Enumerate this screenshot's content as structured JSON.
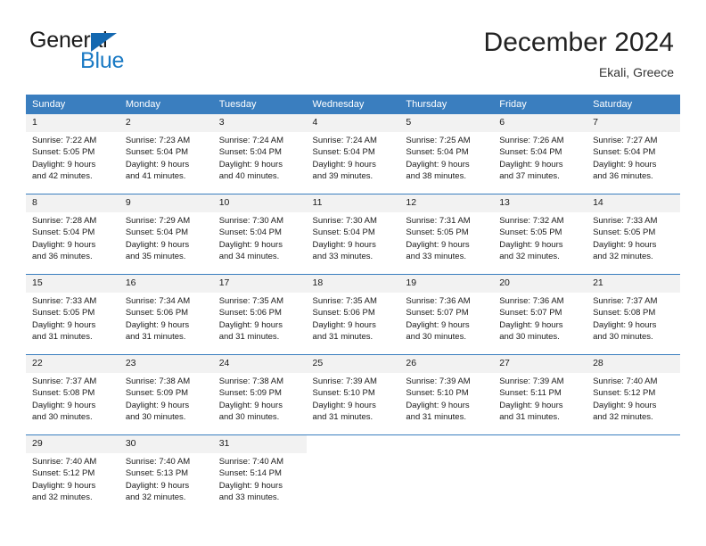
{
  "brand": {
    "word_one": "General",
    "word_two": "Blue",
    "triangle_icon": "blue-triangle-icon",
    "accent_color": "#1a7ac4"
  },
  "header": {
    "title": "December 2024",
    "subtitle": "Ekali, Greece"
  },
  "calendar": {
    "header_color": "#3a7ebf",
    "daynum_bg": "#f2f2f2",
    "weekday_headers": [
      "Sunday",
      "Monday",
      "Tuesday",
      "Wednesday",
      "Thursday",
      "Friday",
      "Saturday"
    ],
    "weeks": [
      [
        {
          "day": "1",
          "sunrise": "Sunrise: 7:22 AM",
          "sunset": "Sunset: 5:05 PM",
          "daylight_line1": "Daylight: 9 hours",
          "daylight_line2": "and 42 minutes."
        },
        {
          "day": "2",
          "sunrise": "Sunrise: 7:23 AM",
          "sunset": "Sunset: 5:04 PM",
          "daylight_line1": "Daylight: 9 hours",
          "daylight_line2": "and 41 minutes."
        },
        {
          "day": "3",
          "sunrise": "Sunrise: 7:24 AM",
          "sunset": "Sunset: 5:04 PM",
          "daylight_line1": "Daylight: 9 hours",
          "daylight_line2": "and 40 minutes."
        },
        {
          "day": "4",
          "sunrise": "Sunrise: 7:24 AM",
          "sunset": "Sunset: 5:04 PM",
          "daylight_line1": "Daylight: 9 hours",
          "daylight_line2": "and 39 minutes."
        },
        {
          "day": "5",
          "sunrise": "Sunrise: 7:25 AM",
          "sunset": "Sunset: 5:04 PM",
          "daylight_line1": "Daylight: 9 hours",
          "daylight_line2": "and 38 minutes."
        },
        {
          "day": "6",
          "sunrise": "Sunrise: 7:26 AM",
          "sunset": "Sunset: 5:04 PM",
          "daylight_line1": "Daylight: 9 hours",
          "daylight_line2": "and 37 minutes."
        },
        {
          "day": "7",
          "sunrise": "Sunrise: 7:27 AM",
          "sunset": "Sunset: 5:04 PM",
          "daylight_line1": "Daylight: 9 hours",
          "daylight_line2": "and 36 minutes."
        }
      ],
      [
        {
          "day": "8",
          "sunrise": "Sunrise: 7:28 AM",
          "sunset": "Sunset: 5:04 PM",
          "daylight_line1": "Daylight: 9 hours",
          "daylight_line2": "and 36 minutes."
        },
        {
          "day": "9",
          "sunrise": "Sunrise: 7:29 AM",
          "sunset": "Sunset: 5:04 PM",
          "daylight_line1": "Daylight: 9 hours",
          "daylight_line2": "and 35 minutes."
        },
        {
          "day": "10",
          "sunrise": "Sunrise: 7:30 AM",
          "sunset": "Sunset: 5:04 PM",
          "daylight_line1": "Daylight: 9 hours",
          "daylight_line2": "and 34 minutes."
        },
        {
          "day": "11",
          "sunrise": "Sunrise: 7:30 AM",
          "sunset": "Sunset: 5:04 PM",
          "daylight_line1": "Daylight: 9 hours",
          "daylight_line2": "and 33 minutes."
        },
        {
          "day": "12",
          "sunrise": "Sunrise: 7:31 AM",
          "sunset": "Sunset: 5:05 PM",
          "daylight_line1": "Daylight: 9 hours",
          "daylight_line2": "and 33 minutes."
        },
        {
          "day": "13",
          "sunrise": "Sunrise: 7:32 AM",
          "sunset": "Sunset: 5:05 PM",
          "daylight_line1": "Daylight: 9 hours",
          "daylight_line2": "and 32 minutes."
        },
        {
          "day": "14",
          "sunrise": "Sunrise: 7:33 AM",
          "sunset": "Sunset: 5:05 PM",
          "daylight_line1": "Daylight: 9 hours",
          "daylight_line2": "and 32 minutes."
        }
      ],
      [
        {
          "day": "15",
          "sunrise": "Sunrise: 7:33 AM",
          "sunset": "Sunset: 5:05 PM",
          "daylight_line1": "Daylight: 9 hours",
          "daylight_line2": "and 31 minutes."
        },
        {
          "day": "16",
          "sunrise": "Sunrise: 7:34 AM",
          "sunset": "Sunset: 5:06 PM",
          "daylight_line1": "Daylight: 9 hours",
          "daylight_line2": "and 31 minutes."
        },
        {
          "day": "17",
          "sunrise": "Sunrise: 7:35 AM",
          "sunset": "Sunset: 5:06 PM",
          "daylight_line1": "Daylight: 9 hours",
          "daylight_line2": "and 31 minutes."
        },
        {
          "day": "18",
          "sunrise": "Sunrise: 7:35 AM",
          "sunset": "Sunset: 5:06 PM",
          "daylight_line1": "Daylight: 9 hours",
          "daylight_line2": "and 31 minutes."
        },
        {
          "day": "19",
          "sunrise": "Sunrise: 7:36 AM",
          "sunset": "Sunset: 5:07 PM",
          "daylight_line1": "Daylight: 9 hours",
          "daylight_line2": "and 30 minutes."
        },
        {
          "day": "20",
          "sunrise": "Sunrise: 7:36 AM",
          "sunset": "Sunset: 5:07 PM",
          "daylight_line1": "Daylight: 9 hours",
          "daylight_line2": "and 30 minutes."
        },
        {
          "day": "21",
          "sunrise": "Sunrise: 7:37 AM",
          "sunset": "Sunset: 5:08 PM",
          "daylight_line1": "Daylight: 9 hours",
          "daylight_line2": "and 30 minutes."
        }
      ],
      [
        {
          "day": "22",
          "sunrise": "Sunrise: 7:37 AM",
          "sunset": "Sunset: 5:08 PM",
          "daylight_line1": "Daylight: 9 hours",
          "daylight_line2": "and 30 minutes."
        },
        {
          "day": "23",
          "sunrise": "Sunrise: 7:38 AM",
          "sunset": "Sunset: 5:09 PM",
          "daylight_line1": "Daylight: 9 hours",
          "daylight_line2": "and 30 minutes."
        },
        {
          "day": "24",
          "sunrise": "Sunrise: 7:38 AM",
          "sunset": "Sunset: 5:09 PM",
          "daylight_line1": "Daylight: 9 hours",
          "daylight_line2": "and 30 minutes."
        },
        {
          "day": "25",
          "sunrise": "Sunrise: 7:39 AM",
          "sunset": "Sunset: 5:10 PM",
          "daylight_line1": "Daylight: 9 hours",
          "daylight_line2": "and 31 minutes."
        },
        {
          "day": "26",
          "sunrise": "Sunrise: 7:39 AM",
          "sunset": "Sunset: 5:10 PM",
          "daylight_line1": "Daylight: 9 hours",
          "daylight_line2": "and 31 minutes."
        },
        {
          "day": "27",
          "sunrise": "Sunrise: 7:39 AM",
          "sunset": "Sunset: 5:11 PM",
          "daylight_line1": "Daylight: 9 hours",
          "daylight_line2": "and 31 minutes."
        },
        {
          "day": "28",
          "sunrise": "Sunrise: 7:40 AM",
          "sunset": "Sunset: 5:12 PM",
          "daylight_line1": "Daylight: 9 hours",
          "daylight_line2": "and 32 minutes."
        }
      ],
      [
        {
          "day": "29",
          "sunrise": "Sunrise: 7:40 AM",
          "sunset": "Sunset: 5:12 PM",
          "daylight_line1": "Daylight: 9 hours",
          "daylight_line2": "and 32 minutes."
        },
        {
          "day": "30",
          "sunrise": "Sunrise: 7:40 AM",
          "sunset": "Sunset: 5:13 PM",
          "daylight_line1": "Daylight: 9 hours",
          "daylight_line2": "and 32 minutes."
        },
        {
          "day": "31",
          "sunrise": "Sunrise: 7:40 AM",
          "sunset": "Sunset: 5:14 PM",
          "daylight_line1": "Daylight: 9 hours",
          "daylight_line2": "and 33 minutes."
        },
        {
          "day": "",
          "sunrise": "",
          "sunset": "",
          "daylight_line1": "",
          "daylight_line2": ""
        },
        {
          "day": "",
          "sunrise": "",
          "sunset": "",
          "daylight_line1": "",
          "daylight_line2": ""
        },
        {
          "day": "",
          "sunrise": "",
          "sunset": "",
          "daylight_line1": "",
          "daylight_line2": ""
        },
        {
          "day": "",
          "sunrise": "",
          "sunset": "",
          "daylight_line1": "",
          "daylight_line2": ""
        }
      ]
    ]
  }
}
